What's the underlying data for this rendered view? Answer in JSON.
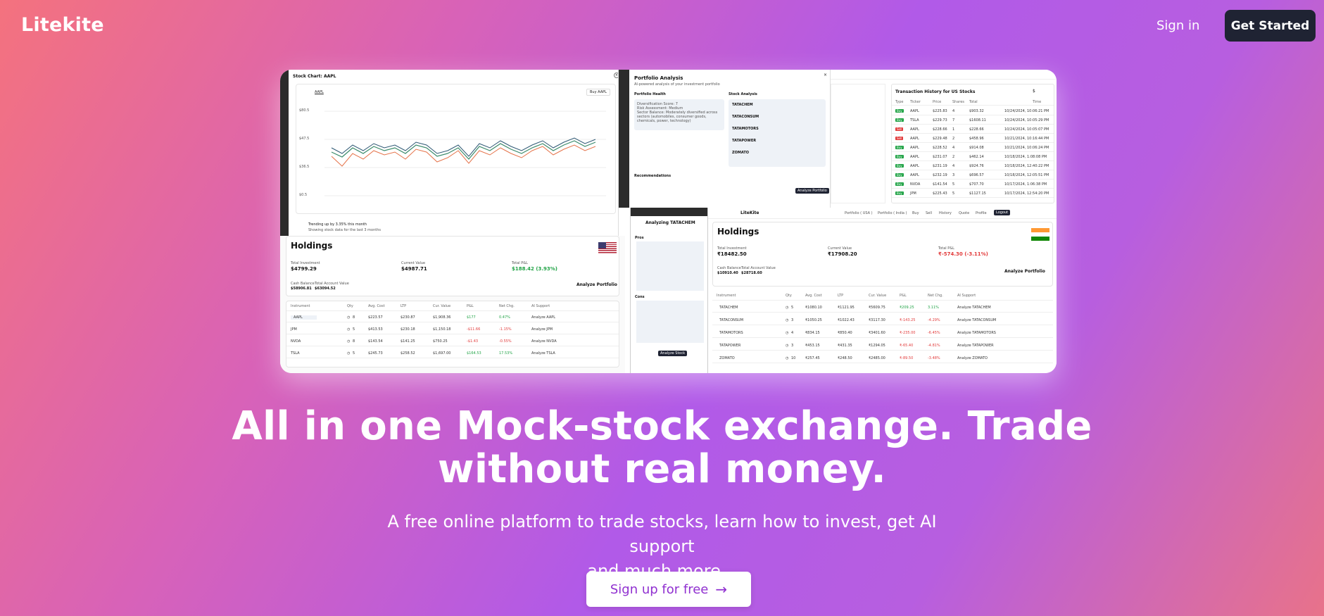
{
  "nav": {
    "logo": "Litekite",
    "signin": "Sign in",
    "get_started": "Get Started"
  },
  "hero": {
    "headline_line1": "All in one Mock-stock exchange. Trade",
    "headline_line2": "without real money.",
    "sub_line1": "A free online platform to trade stocks, learn how to invest, get AI support",
    "sub_line2": "and much more...",
    "cta": "Sign up for free"
  },
  "screenshot": {
    "chart_panel": {
      "title": "Stock Chart: AAPL",
      "tab": "AAPL",
      "buy": "Buy AAPL",
      "trend": "Trending up by 3.35% this month",
      "trend_note": "Showing stock data for the last 3 months",
      "y_ticks": [
        "$80.5",
        "$47.5",
        "$36.5",
        "$0.5"
      ]
    },
    "holdings_us": {
      "title": "Holdings",
      "total_investment_label": "Total Investment",
      "total_investment": "$4799.29",
      "current_value_label": "Current Value",
      "current_value": "$4987.71",
      "total_pnl_label": "Total P&L",
      "total_pnl": "$188.42 (3.93%)",
      "cash_label": "Cash Balance",
      "cash": "$58906.81",
      "account_label": "Total Account Value",
      "account": "$63094.52",
      "analyze": "Analyze Portfolio",
      "headers": [
        "Instrument",
        "Qty",
        "Avg. Cost",
        "LTP",
        "Cur. Value",
        "P&L",
        "Net Chg.",
        "AI Support"
      ],
      "rows": [
        [
          "AAPL",
          "8",
          "$223.57",
          "$230.87",
          "$1,908.36",
          "$177",
          "0.47%",
          "Analyze AAPL"
        ],
        [
          "JPM",
          "5",
          "$413.53",
          "$230.18",
          "$1,150.18",
          "-$11.66",
          "-1.15%",
          "Analyze JPM"
        ],
        [
          "NVDA",
          "8",
          "$143.54",
          "$141.25",
          "$750.25",
          "-$1.43",
          "-0.55%",
          "Analyze NVDA"
        ],
        [
          "TSLA",
          "5",
          "$245.73",
          "$258.52",
          "$1,697.00",
          "$164.53",
          "17.53%",
          "Analyze TSLA"
        ]
      ]
    },
    "portfolio_analysis": {
      "title": "Portfolio Analysis",
      "subtitle": "AI-powered analysis of your investment portfolio",
      "health": "Portfolio Health",
      "health_lines": [
        "Diversification Score: 7",
        "Risk Assessment: Medium",
        "Sector Balance: Moderately diversified across sectors (automobiles, consumer goods, chemicals, power, technology)"
      ],
      "stock_analysis": "Stock Analysis",
      "stocks": [
        "TATACHEM",
        "TATACONSUM",
        "TATAMOTORS",
        "TATAPOWER",
        "ZOMATO"
      ],
      "recommendation": "Recommendations",
      "analyze": "Analyze Portfolio"
    },
    "analyzing": {
      "title": "Analyzing TATACHEM",
      "pros": "Pros",
      "cons": "Cons",
      "button": "Analyze Stock"
    },
    "tx_history": {
      "title": "Transaction History for US Stocks",
      "currency": "$",
      "headers": [
        "Type",
        "Ticker",
        "Price",
        "Shares",
        "Total",
        "Time"
      ],
      "rows": [
        [
          "Buy",
          "AAPL",
          "$225.83",
          "4",
          "$903.32",
          "10/24/2024, 10:06:21 PM"
        ],
        [
          "Buy",
          "TSLA",
          "$229.73",
          "7",
          "$1608.11",
          "10/24/2024, 10:05:29 PM"
        ],
        [
          "Sell",
          "AAPL",
          "$228.66",
          "1",
          "$228.66",
          "10/24/2024, 10:05:07 PM"
        ],
        [
          "Sell",
          "AAPL",
          "$229.48",
          "2",
          "$458.96",
          "10/21/2024, 10:16:44 PM"
        ],
        [
          "Buy",
          "AAPL",
          "$228.52",
          "4",
          "$914.08",
          "10/21/2024, 10:06:24 PM"
        ],
        [
          "Buy",
          "AAPL",
          "$231.07",
          "2",
          "$462.14",
          "10/18/2024, 1:08:08 PM"
        ],
        [
          "Buy",
          "AAPL",
          "$231.19",
          "4",
          "$924.76",
          "10/18/2024, 12:40:22 PM"
        ],
        [
          "Buy",
          "AAPL",
          "$232.19",
          "3",
          "$696.57",
          "10/18/2024, 12:05:51 PM"
        ],
        [
          "Buy",
          "NVDA",
          "$141.54",
          "5",
          "$707.70",
          "10/17/2024, 1:06:38 PM"
        ],
        [
          "Buy",
          "JPM",
          "$225.43",
          "5",
          "$1127.15",
          "10/17/2024, 12:54:20 PM"
        ]
      ]
    },
    "holdings_in": {
      "brand": "LiteKite",
      "nav": [
        "Portfolio ( USA )",
        "Portfolio ( India )",
        "Buy",
        "Sell",
        "History",
        "Quote",
        "Profile",
        "Logout"
      ],
      "title": "Holdings",
      "total_investment_label": "Total Investment",
      "total_investment": "₹18482.50",
      "current_value_label": "Current Value",
      "current_value": "₹17908.20",
      "total_pnl_label": "Total P&L",
      "total_pnl": "₹-574.30 (-3.11%)",
      "cash_label": "Cash Balance",
      "cash": "$10910.40",
      "account_label": "Total Account Value",
      "account": "$28718.60",
      "analyze": "Analyze Portfolio",
      "headers": [
        "Instrument",
        "Qty",
        "Avg. Cost",
        "LTP",
        "Cur. Value",
        "P&L",
        "Net Chg.",
        "AI Support"
      ],
      "rows": [
        [
          "TATACHEM",
          "5",
          "₹1080.10",
          "₹1121.95",
          "₹5609.75",
          "₹209.25",
          "3.11%",
          "Analyze TATACHEM"
        ],
        [
          "TATACONSUM",
          "3",
          "₹1050.25",
          "₹1022.43",
          "₹3117.30",
          "₹-143.25",
          "-4.29%",
          "Analyze TATACONSUM"
        ],
        [
          "TATAMOTORS",
          "4",
          "₹834.15",
          "₹850.40",
          "₹3401.60",
          "₹-235.00",
          "-6.45%",
          "Analyze TATAMOTORS"
        ],
        [
          "TATAPOWER",
          "3",
          "₹453.15",
          "₹431.35",
          "₹1294.05",
          "₹-65.40",
          "-4.81%",
          "Analyze TATAPOWER"
        ],
        [
          "ZOMATO",
          "10",
          "₹257.45",
          "₹248.50",
          "₹2485.00",
          "₹-89.50",
          "-3.48%",
          "Analyze ZOMATO"
        ]
      ]
    }
  }
}
